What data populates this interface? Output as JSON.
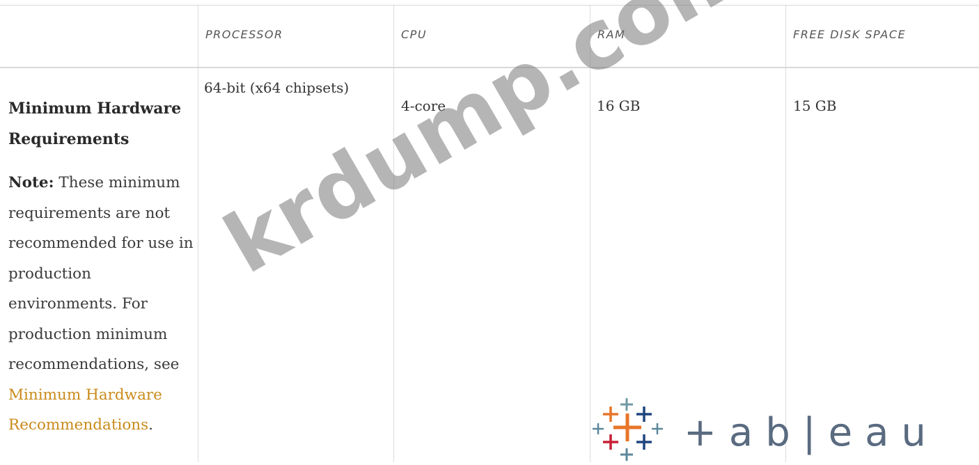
{
  "table": {
    "headers": [
      "PROCESSOR",
      "CPU",
      "RAM",
      "FREE DISK SPACE"
    ],
    "row": {
      "title": "Minimum Hardware Requirements",
      "processor": "64-bit (x64 chipsets)",
      "cpu": "4-core",
      "ram": "16 GB",
      "disk": "15 GB"
    },
    "note": {
      "label": "Note:",
      "text": " These minimum requirements are not recommended for use in production environments. For production minimum recommendations, see ",
      "link_text": "Minimum Hardware Recommendations",
      "end": "."
    }
  },
  "watermark": "krdump.com",
  "logo": {
    "text": "tableau",
    "icon": "tableau-plus-cluster-icon",
    "colors": [
      "#e8762b",
      "#c72035",
      "#5b879b",
      "#1f457e",
      "#7099a6"
    ]
  }
}
